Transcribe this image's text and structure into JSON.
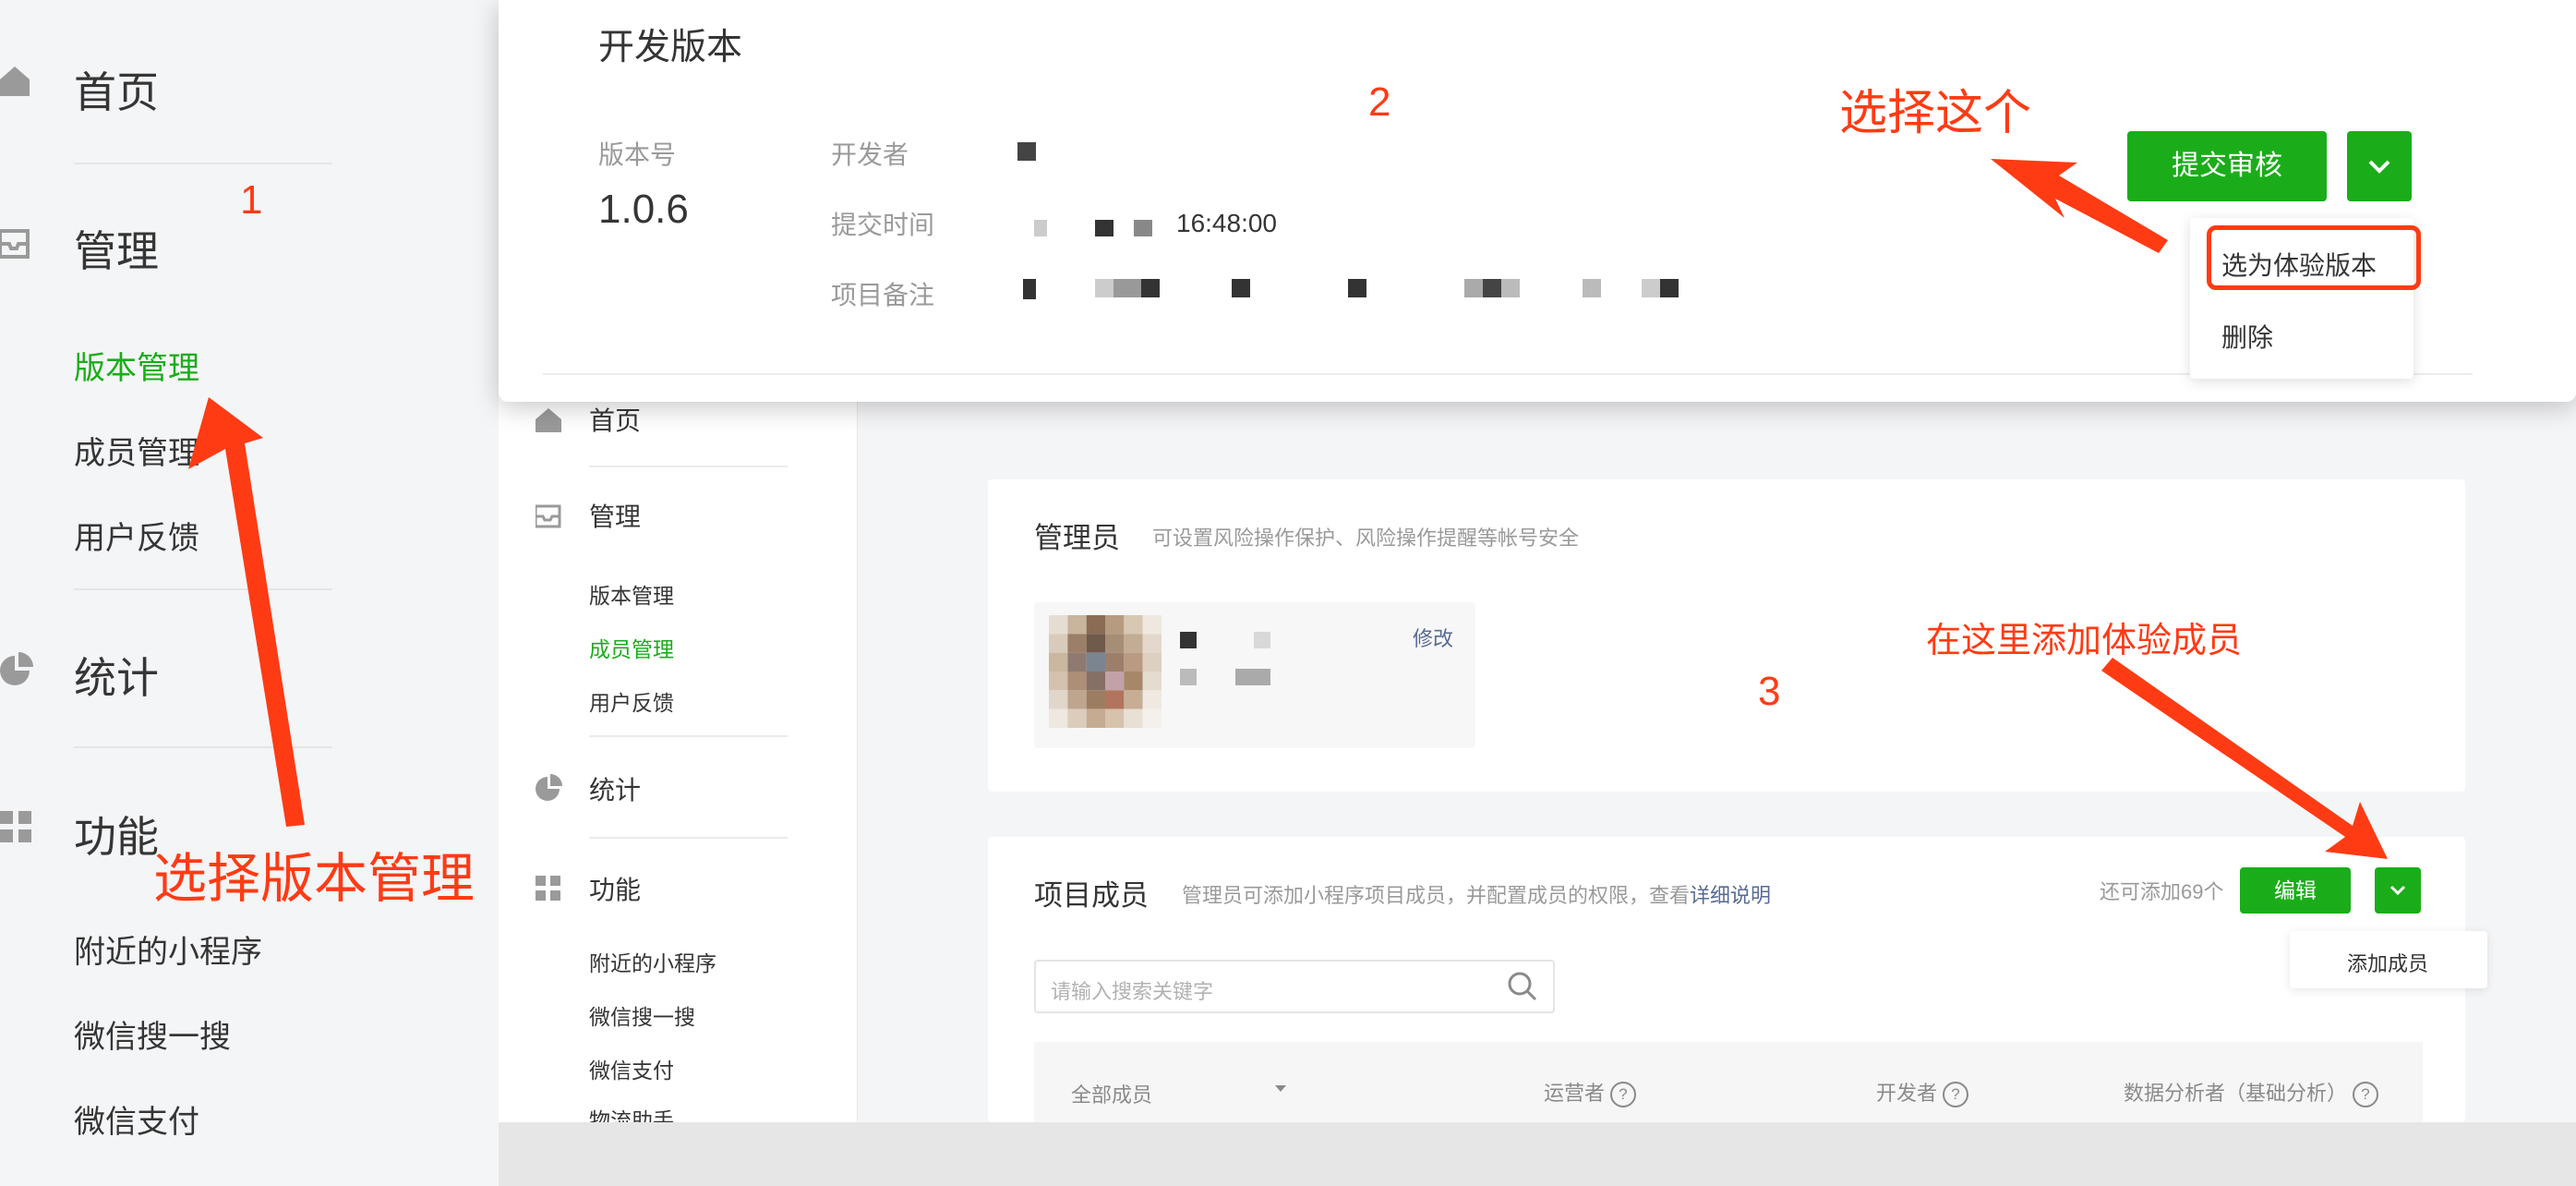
{
  "left_sidebar": {
    "home": "首页",
    "manage": "管理",
    "manage_items": [
      "版本管理",
      "成员管理",
      "用户反馈"
    ],
    "stats": "统计",
    "features": "功能",
    "feature_items": [
      "附近的小程序",
      "微信搜一搜",
      "微信支付"
    ]
  },
  "dev_version": {
    "title": "开发版本",
    "version_label": "版本号",
    "version_value": "1.0.6",
    "developer_label": "开发者",
    "submit_time_label": "提交时间",
    "submit_time_value": "16:48:00",
    "remark_label": "项目备注",
    "submit_review_button": "提交审核",
    "dropdown": [
      "选为体验版本",
      "删除"
    ]
  },
  "member_page": {
    "sidebar": {
      "home": "首页",
      "manage": "管理",
      "manage_items": [
        "版本管理",
        "成员管理",
        "用户反馈"
      ],
      "stats": "统计",
      "features": "功能",
      "feature_items": [
        "附近的小程序",
        "微信搜一搜",
        "微信支付",
        "物流助手"
      ]
    },
    "admin": {
      "title": "管理员",
      "desc": "可设置风险操作保护、风险操作提醒等帐号安全",
      "modify_link": "修改"
    },
    "members": {
      "title": "项目成员",
      "desc": "管理员可添加小程序项目成员，并配置成员的权限，查看",
      "detail_link": "详细说明",
      "remaining": "还可添加69个",
      "edit_button": "编辑",
      "add_member": "添加成员",
      "search_placeholder": "请输入搜索关键字",
      "columns": [
        "全部成员",
        "运营者",
        "开发者",
        "数据分析者（基础分析）"
      ]
    }
  },
  "annotations": {
    "step1": "1",
    "step2": "2",
    "step3": "3",
    "choose_version_mgmt": "选择版本管理",
    "choose_this": "选择这个",
    "add_tester_here": "在这里添加体验成员"
  },
  "colors": {
    "accent_green": "#1aad19",
    "annotation_red": "#ff3b14",
    "link_blue": "#576b95"
  }
}
